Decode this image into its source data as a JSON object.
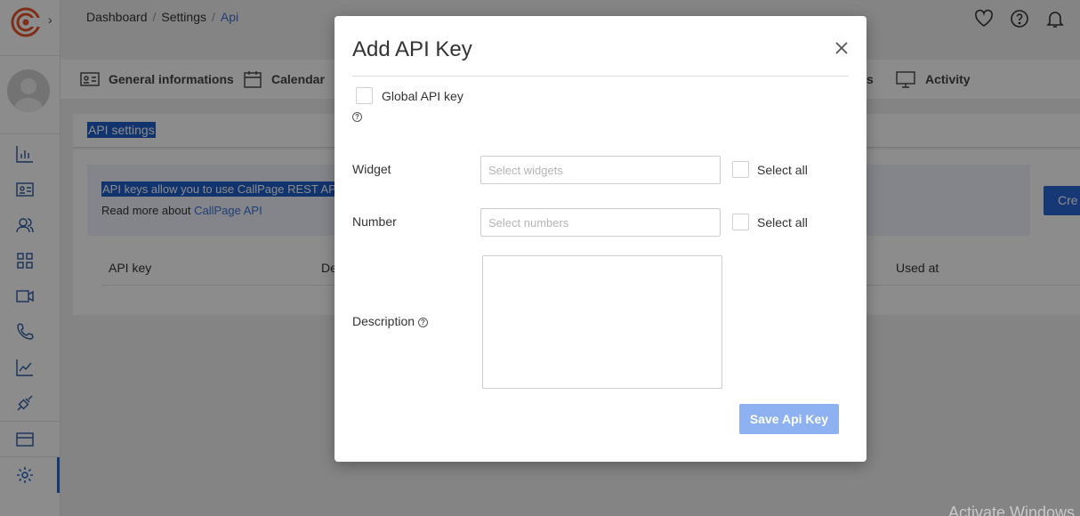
{
  "breadcrumb": {
    "items": [
      "Dashboard",
      "Settings"
    ],
    "current": "Api"
  },
  "tabs": [
    {
      "label": "General informations",
      "icon": "id-card-icon"
    },
    {
      "label": "Calendar",
      "icon": "calendar-icon"
    },
    {
      "label": "s",
      "icon": ""
    },
    {
      "label": "Activity",
      "icon": "monitor-icon"
    }
  ],
  "section": {
    "title": "API settings"
  },
  "info": {
    "line1": "API keys allow you to use CallPage REST API",
    "line2_prefix": "Read more about",
    "line2_link": "CallPage API"
  },
  "create_button": "Cre",
  "table": {
    "headers": [
      "API key",
      "De",
      "Used at"
    ]
  },
  "watermark": "Activate Windows",
  "modal": {
    "title": "Add API Key",
    "global_label": "Global API key",
    "help_glyph": "?",
    "widget_label": "Widget",
    "widget_placeholder": "Select widgets",
    "number_label": "Number",
    "number_placeholder": "Select numbers",
    "select_all": "Select all",
    "description_label": "Description",
    "save_label": "Save Api Key"
  },
  "colors": {
    "accent": "#2866d3",
    "save_disabled": "#8eb1f1",
    "link": "#3b72d6"
  }
}
